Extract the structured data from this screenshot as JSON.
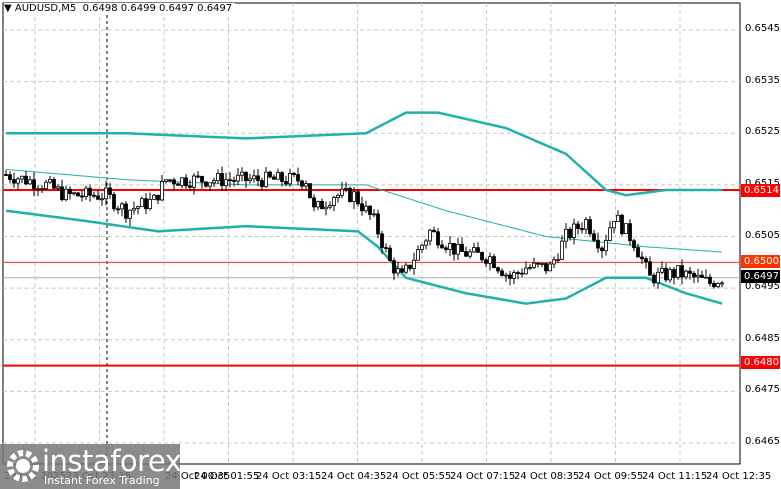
{
  "header": {
    "symbol": "AUDUSD,M5",
    "ohlc": "0.6498 0.6499 0.6497 0.6497"
  },
  "price_axis": [
    "0.6545",
    "0.6535",
    "0.6525",
    "0.6515",
    "0.6505",
    "0.6495",
    "0.6485",
    "0.6475",
    "0.6465"
  ],
  "levels": {
    "resistance": "0.6514",
    "pivot": "0.6500",
    "current": "0.6497",
    "support": "0.6480"
  },
  "colors": {
    "level": "#ff0000",
    "pivot": "#ff3300",
    "band": "#20b2aa",
    "candle": "#000000"
  },
  "time_axis": [
    "23 Oct 2025",
    "23 Oct 23:15",
    "24 Oct 00:35",
    "24 Oct 01:55",
    "24 Oct 03:15",
    "24 Oct 04:35",
    "24 Oct 05:55",
    "24 Oct 07:15",
    "24 Oct 08:35",
    "24 Oct 09:55",
    "24 Oct 11:15",
    "24 Oct 12:35"
  ],
  "logo": {
    "name": "instaforex",
    "tagline": "Instant Forex Trading"
  },
  "chart_data": {
    "type": "candlestick",
    "close_path": [
      [
        0,
        0.6517
      ],
      [
        10,
        0.6515
      ],
      [
        15,
        0.6513
      ],
      [
        25,
        0.6513
      ],
      [
        30,
        0.651
      ],
      [
        37,
        0.6512
      ],
      [
        40,
        0.6516
      ],
      [
        75,
        0.6516
      ],
      [
        77,
        0.651
      ],
      [
        82,
        0.6513
      ],
      [
        87,
        0.6513
      ],
      [
        92,
        0.6508
      ],
      [
        96,
        0.65
      ],
      [
        99,
        0.6497
      ],
      [
        106,
        0.6506
      ],
      [
        113,
        0.6502
      ],
      [
        121,
        0.6501
      ],
      [
        126,
        0.6497
      ],
      [
        130,
        0.6499
      ],
      [
        136,
        0.6499
      ],
      [
        140,
        0.6505
      ],
      [
        145,
        0.6508
      ],
      [
        149,
        0.6503
      ],
      [
        152,
        0.6509
      ],
      [
        157,
        0.6504
      ],
      [
        161,
        0.6497
      ],
      [
        168,
        0.6498
      ],
      [
        176,
        0.6496
      ],
      [
        179,
        0.6497
      ]
    ],
    "upper_band": [
      [
        0,
        0.6525
      ],
      [
        30,
        0.6525
      ],
      [
        60,
        0.6524
      ],
      [
        90,
        0.6525
      ],
      [
        95,
        0.6527
      ],
      [
        100,
        0.6529
      ],
      [
        108,
        0.6529
      ],
      [
        125,
        0.6526
      ],
      [
        140,
        0.6521
      ],
      [
        150,
        0.6514
      ],
      [
        155,
        0.6513
      ],
      [
        165,
        0.6514
      ],
      [
        179,
        0.6514
      ]
    ],
    "lower_band": [
      [
        0,
        0.651
      ],
      [
        20,
        0.6508
      ],
      [
        38,
        0.6506
      ],
      [
        60,
        0.6507
      ],
      [
        88,
        0.6506
      ],
      [
        93,
        0.6503
      ],
      [
        100,
        0.6497
      ],
      [
        115,
        0.6494
      ],
      [
        130,
        0.6492
      ],
      [
        140,
        0.6493
      ],
      [
        150,
        0.6497
      ],
      [
        160,
        0.6497
      ],
      [
        170,
        0.6494
      ],
      [
        179,
        0.6492
      ]
    ],
    "middle_ma": [
      [
        0,
        0.6518
      ],
      [
        30,
        0.6516
      ],
      [
        60,
        0.6515
      ],
      [
        90,
        0.6515
      ],
      [
        110,
        0.651
      ],
      [
        135,
        0.6505
      ],
      [
        160,
        0.6503
      ],
      [
        179,
        0.6502
      ]
    ],
    "ylim": [
      0.646,
      0.655
    ]
  }
}
